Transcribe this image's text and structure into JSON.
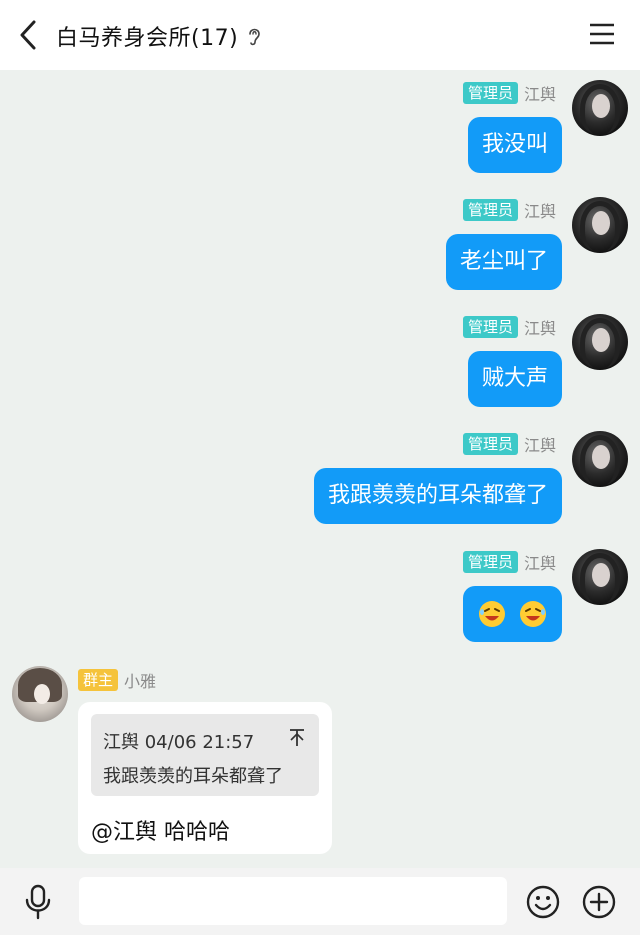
{
  "header": {
    "title": "白马养身会所(17)",
    "back_icon": "chevron-left-icon",
    "ear_icon": "ear-icon",
    "menu_icon": "hamburger-menu-icon"
  },
  "messages": [
    {
      "badge": "管理员",
      "sender": "江舆",
      "text": "我没叫"
    },
    {
      "badge": "管理员",
      "sender": "江舆",
      "text": "老尘叫了"
    },
    {
      "badge": "管理员",
      "sender": "江舆",
      "text": "贼大声"
    },
    {
      "badge": "管理员",
      "sender": "江舆",
      "text": "我跟羡羡的耳朵都聋了"
    },
    {
      "badge": "管理员",
      "sender": "江舆",
      "emoji": [
        "laughing-face-icon",
        "laughing-face-icon"
      ]
    }
  ],
  "reply_message": {
    "badge": "群主",
    "sender": "小雅",
    "quote_header": "江舆 04/06 21:57",
    "quote_text": "我跟羡羡的耳朵都聋了",
    "text": "@江舆 哈哈哈"
  },
  "input_bar": {
    "placeholder": "",
    "value": ""
  },
  "colors": {
    "admin_badge": "#3dc9c8",
    "owner_badge": "#f5c33b",
    "bubble_blue": "#129bf8",
    "background": "#edf1ee"
  }
}
